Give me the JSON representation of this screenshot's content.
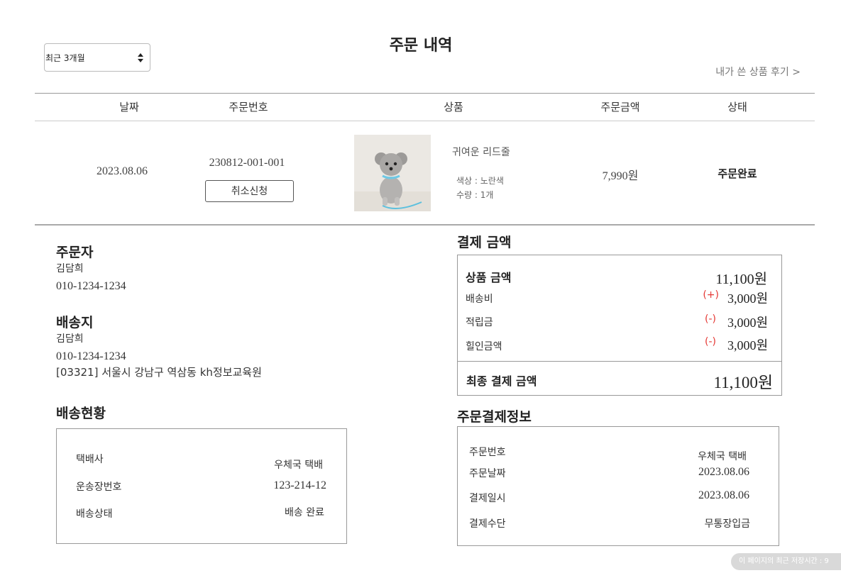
{
  "header": {
    "period_select": "최근 3개월",
    "title": "주문 내역",
    "review_link": "내가 쓴 상품 후기 >"
  },
  "table": {
    "columns": [
      "날짜",
      "주문번호",
      "상품",
      "주문금액",
      "상태"
    ],
    "row": {
      "date": "2023.08.06",
      "order_no": "230812-001-001",
      "cancel_label": "취소신청",
      "product_name": "귀여운 리드줄",
      "option_color": "색상 : 노란색",
      "option_qty": "수량 : 1개",
      "amount": "7,990원",
      "status": "주문완료"
    }
  },
  "orderer": {
    "title": "주문자",
    "name": "김담희",
    "phone": "010-1234-1234"
  },
  "shipping_address": {
    "title": "배송지",
    "name": "김담희",
    "phone": "010-1234-1234",
    "address": "[03321] 서울시 강남구 역삼동 kh정보교육원"
  },
  "delivery_status": {
    "title": "배송현황",
    "rows": [
      {
        "label": "택배사",
        "value": "우체국 택배"
      },
      {
        "label": "운송장번호",
        "value": "123-214-12"
      },
      {
        "label": "배송상태",
        "value": "배송 완료"
      }
    ]
  },
  "payment_amount": {
    "title": "결제 금액",
    "product_label": "상품 금액",
    "product_value": "11,100원",
    "rows": [
      {
        "label": "배송비",
        "sign": "(+)",
        "value": "3,000원"
      },
      {
        "label": "적립금",
        "sign": "(-)",
        "value": "3,000원"
      },
      {
        "label": "힐인금액",
        "sign": "(-)",
        "value": "3,000원"
      }
    ],
    "final_label": "최종 결제 금액",
    "final_value": "11,100원"
  },
  "payment_info": {
    "title": "주문결제정보",
    "rows": [
      {
        "label": "주문번호",
        "value": "우체국 택배"
      },
      {
        "label": "주문날짜",
        "value": "2023.08.06"
      },
      {
        "label": "결제일시",
        "value": "2023.08.06"
      },
      {
        "label": "결제수단",
        "value": "무통장입금"
      }
    ]
  },
  "footer_badge": "이 페이지의 최근 저장시간 : 9",
  "colors": {
    "accent_red": "#e53935",
    "line": "#999999"
  }
}
